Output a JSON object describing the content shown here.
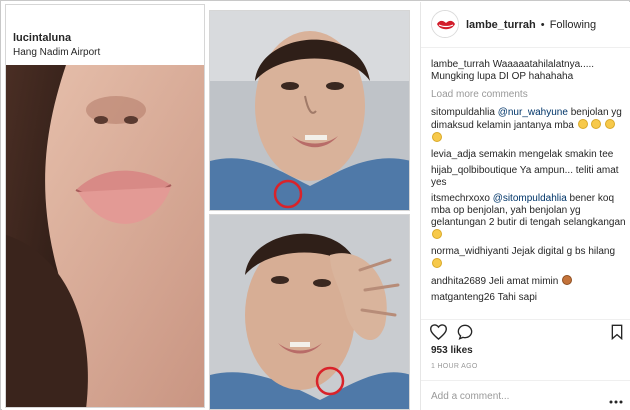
{
  "collage": {
    "username": "lucintaluna",
    "location": "Hang Nadim Airport"
  },
  "post": {
    "author": "lambe_turrah",
    "follow_separator": "•",
    "follow_label": "Following",
    "caption_user": "lambe_turrah",
    "caption_text": "Waaaaatahilalatnya..... Mungking lupa DI OP hahahaha",
    "load_more": "Load more comments",
    "likes": "953 likes",
    "timestamp": "1 HOUR AGO",
    "add_comment_placeholder": "Add a comment..."
  },
  "comments": [
    {
      "user": "sitompuldahlia",
      "mention": "@nur_wahyune",
      "text": "benjolan yg dimaksud kelamin jantanya mba",
      "emoji_count": 4
    },
    {
      "user": "levia_adja",
      "mention": "",
      "text": "semakin mengelak smakin tee",
      "emoji_count": 0
    },
    {
      "user": "hijab_qolbiboutique",
      "mention": "",
      "text": "Ya ampun... teliti amat yes",
      "emoji_count": 0
    },
    {
      "user": "itsmechrxoxo",
      "mention": "@sitompuldahlia",
      "text": "bener koq mba op benjolan, yah benjolan yg gelantungan 2 butir di tengah selangkangan",
      "emoji_count": 1
    },
    {
      "user": "norma_widhiyanti",
      "mention": "",
      "text": "Jejak digital g bs hilang",
      "emoji_count": 1
    },
    {
      "user": "andhita2689",
      "mention": "",
      "text": "Jeli amat mimin",
      "emoji_count": 1
    },
    {
      "user": "matganteng26",
      "mention": "",
      "text": "Tahi sapi",
      "emoji_count": 0
    }
  ],
  "icons": {
    "like": "heart-outline-icon",
    "comment": "speech-bubble-icon",
    "save": "bookmark-icon",
    "more": "more-dots-icon"
  },
  "colors": {
    "mention": "#003569",
    "muted": "#999999",
    "text": "#262626",
    "marker_circle": "#d9232a"
  }
}
